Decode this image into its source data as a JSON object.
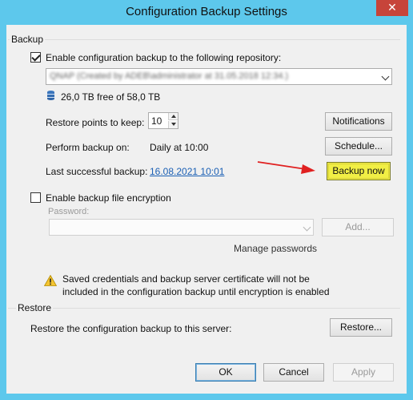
{
  "window": {
    "title": "Configuration Backup Settings",
    "close_label": "✕"
  },
  "backup": {
    "group_label": "Backup",
    "enable_label": "Enable configuration backup to the following repository:",
    "enable_checked": true,
    "repository_value": "QNAP (Created by ADEB\\administrator at 31.05.2018 12:34.)",
    "free_space": "26,0 TB free of 58,0 TB",
    "restore_points_label": "Restore points to keep:",
    "restore_points_value": "10",
    "notifications_button": "Notifications",
    "perform_label": "Perform backup on:",
    "perform_value": "Daily at 10:00",
    "schedule_button": "Schedule...",
    "last_label": "Last successful backup:",
    "last_value": "16.08.2021 10:01",
    "backup_now_button": "Backup now",
    "encryption_label": "Enable backup file encryption",
    "encryption_checked": false,
    "password_label": "Password:",
    "password_value": "",
    "add_button": "Add...",
    "manage_passwords": "Manage passwords",
    "warning_line1": "Saved credentials and backup server certificate will not be",
    "warning_line2": "included in the configuration backup until encryption is enabled"
  },
  "restore": {
    "group_label": "Restore",
    "restore_label": "Restore the configuration backup to this server:",
    "restore_button": "Restore..."
  },
  "footer": {
    "ok": "OK",
    "cancel": "Cancel",
    "apply": "Apply"
  },
  "colors": {
    "titlebar": "#5dc8ec",
    "close": "#c7443a",
    "highlight": "#f1ef45",
    "arrow": "#e02020",
    "link": "#1a5fb4"
  }
}
